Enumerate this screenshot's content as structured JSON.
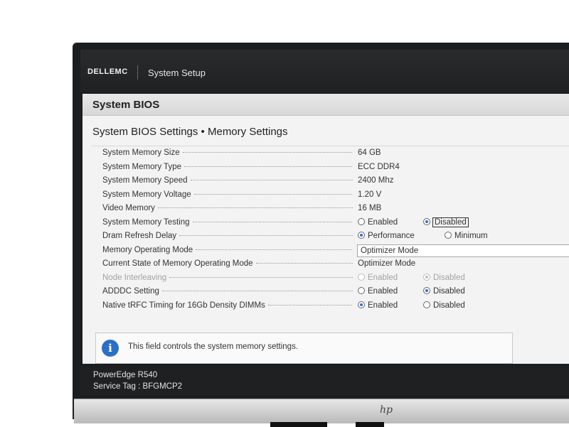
{
  "header": {
    "brand": "DELLEMC",
    "app_title": "System Setup"
  },
  "panel": {
    "title": "System BIOS",
    "section_title": "System BIOS Settings • Memory Settings"
  },
  "settings": [
    {
      "label": "System Memory Size",
      "value": "64 GB"
    },
    {
      "label": "System Memory Type",
      "value": "ECC DDR4"
    },
    {
      "label": "System Memory Speed",
      "value": "2400 Mhz"
    },
    {
      "label": "System Memory Voltage",
      "value": "1.20 V"
    },
    {
      "label": "Video Memory",
      "value": "16 MB"
    },
    {
      "label": "System Memory Testing",
      "options": [
        "Enabled",
        "Disabled"
      ],
      "selected": "Disabled"
    },
    {
      "label": "Dram Refresh Delay",
      "options": [
        "Performance",
        "Minimum"
      ],
      "selected": "Performance"
    },
    {
      "label": "Memory Operating Mode",
      "value": "Optimizer Mode"
    },
    {
      "label": "Current State of Memory Operating Mode",
      "value": "Optimizer Mode"
    },
    {
      "label": "Node Interleaving",
      "options": [
        "Enabled",
        "Disabled"
      ],
      "selected": "Disabled",
      "disabled": true
    },
    {
      "label": "ADDDC Setting",
      "options": [
        "Enabled",
        "Disabled"
      ],
      "selected": "Disabled"
    },
    {
      "label": "Native tRFC Timing for 16Gb Density DIMMs",
      "options": [
        "Enabled",
        "Disabled"
      ],
      "selected": "Enabled"
    }
  ],
  "help": {
    "icon": "info-icon",
    "text": "This field controls the system memory settings."
  },
  "footer": {
    "model": "PowerEdge R540",
    "service_tag": "Service Tag : BFGMCP2"
  },
  "monitor": {
    "logo": "hp"
  },
  "colors": {
    "accent": "#2d6fd6",
    "info": "#2b6fc7",
    "bar": "#202123"
  }
}
